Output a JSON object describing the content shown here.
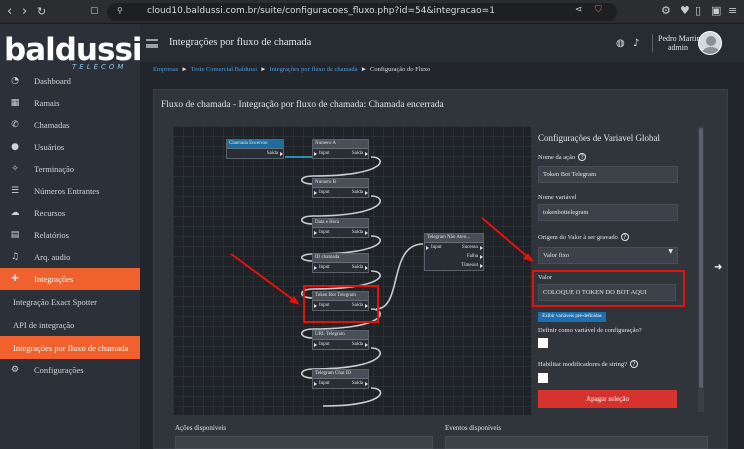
{
  "browser": {
    "url": "cloud10.baldussi.com.br/suite/configuracoes_fluxo.php?id=54&integracao=1"
  },
  "sidebar": {
    "logo": "baldussi",
    "logo_sub": "TELECOM",
    "items": [
      {
        "label": "Dashboard",
        "icon": "dashboard-icon",
        "glyph": "◔"
      },
      {
        "label": "Ramais",
        "icon": "extensions-icon",
        "glyph": "▦"
      },
      {
        "label": "Chamadas",
        "icon": "phone-icon",
        "glyph": "✆"
      },
      {
        "label": "Usuários",
        "icon": "user-icon",
        "glyph": "●"
      },
      {
        "label": "Terminação",
        "icon": "satellite-icon",
        "glyph": "✧"
      },
      {
        "label": "Números Entrantes",
        "icon": "inbound-numbers-icon",
        "glyph": "☰"
      },
      {
        "label": "Recursos",
        "icon": "cloud-icon",
        "glyph": "☁"
      },
      {
        "label": "Relatórios",
        "icon": "report-icon",
        "glyph": "▤"
      },
      {
        "label": "Arq. audio",
        "icon": "audio-file-icon",
        "glyph": "♫"
      },
      {
        "label": "Integrações",
        "icon": "puzzle-icon",
        "glyph": "✚"
      },
      {
        "label": "Integração Exact Spotter",
        "sub": true
      },
      {
        "label": "API de integração",
        "sub": true
      },
      {
        "label": "Integrações por fluxo de chamada",
        "sub": true
      },
      {
        "label": "Configurações",
        "icon": "gear-icon",
        "glyph": "⚙"
      }
    ]
  },
  "topbar": {
    "title": "Integrações por fluxo de chamada",
    "user_name": "Pedro Martins",
    "user_role": "admin"
  },
  "breadcrumb": {
    "items": [
      "Empresas",
      "Teste Comercial Baldussi",
      "Integrações por fluxo de chamada"
    ],
    "current": "Configuração do Fluxo",
    "sep": "►"
  },
  "panel": {
    "title": "Fluxo de chamada - Integração por fluxo de chamada: Chamada encerrada"
  },
  "nodes": {
    "start": {
      "title": "Chamada Encerrou",
      "out": "Saída"
    },
    "numero_a": {
      "title": "Numero A",
      "in": "Input",
      "out": "Saída"
    },
    "numero_b": {
      "title": "Numero B",
      "in": "Input",
      "out": "Saída"
    },
    "data_hora": {
      "title": "Data e Hora",
      "in": "Input",
      "out": "Saída"
    },
    "id_chamada": {
      "title": "ID chamada",
      "in": "Input",
      "out": "Saída"
    },
    "token_bot": {
      "title": "Token Bot Telegram",
      "in": "Input",
      "out": "Saída"
    },
    "url_telegram": {
      "title": "URL Telegram",
      "in": "Input",
      "out": "Saída"
    },
    "chat_id": {
      "title": "Telegram Chat ID",
      "in": "Input",
      "out": "Saída"
    },
    "telegram": {
      "title": "Telegram Não Aten...",
      "in": "Input",
      "out1": "Sucesso",
      "out2": "Falha",
      "out3": "Timeout"
    }
  },
  "config": {
    "title": "Configurações de Variavel Global",
    "acao_label": "Nome da ação",
    "acao_value": "Token Bot Telegram",
    "variavel_label": "Nome variável",
    "variavel_value": "tokenbottelegram",
    "origem_label": "Origem do Valor à ser gravado",
    "origem_value": "Valor fixo",
    "valor_label": "Valor",
    "valor_value": "COLOQUE O TOKEN  DO BOT AQUI",
    "predef_button": "Exibir variáveis pré-definidas",
    "config_var_label": "Definir como variável de configuração?",
    "mod_string_label": "Habilitar modificadores de string?",
    "delete_button": "Apagar seleção"
  },
  "bottom": {
    "acoes_label": "Ações disponíveis",
    "eventos_label": "Eventos disponíveis"
  },
  "colors": {
    "accent": "#f0612d",
    "link": "#4c9be0",
    "highlight": "#e3120b",
    "node_header_start": "#1c6d9d",
    "danger": "#d6332e"
  }
}
